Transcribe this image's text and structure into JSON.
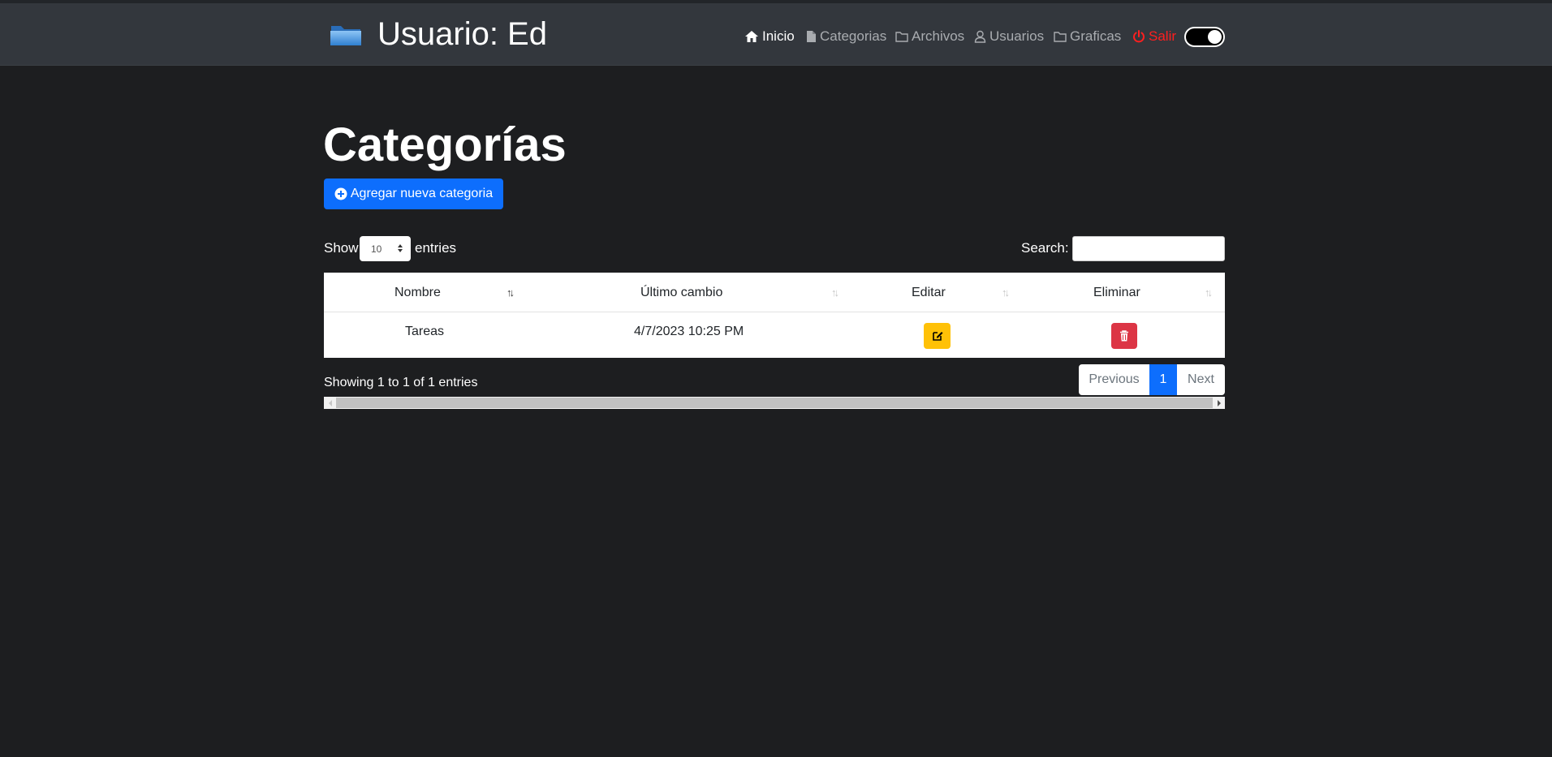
{
  "header": {
    "title": "Usuario: Ed",
    "nav": {
      "inicio": "Inicio",
      "categorias": "Categorias",
      "archivos": "Archivos",
      "usuarios": "Usuarios",
      "graficas": "Graficas",
      "salir": "Salir"
    }
  },
  "page": {
    "title": "Categorías",
    "add_button": "Agregar nueva categoria"
  },
  "table_controls": {
    "show_label": "Show",
    "page_length": "10",
    "entries_label": "entries",
    "search_label": "Search:",
    "search_value": ""
  },
  "table": {
    "columns": [
      "Nombre",
      "Último cambio",
      "Editar",
      "Eliminar"
    ],
    "rows": [
      {
        "nombre": "Tareas",
        "ultimo_cambio": "4/7/2023 10:25 PM"
      }
    ]
  },
  "footer": {
    "info": "Showing 1 to 1 of 1 entries",
    "previous": "Previous",
    "current_page": "1",
    "next": "Next"
  },
  "colors": {
    "background": "#1d1e20",
    "navbar": "#33373d",
    "primary": "#0d6efd",
    "warning": "#ffc107",
    "danger": "#dc3545",
    "logout": "#ff1f1f"
  },
  "icons": [
    "folder-icon",
    "home-icon",
    "file-icon",
    "folder-outline-icon",
    "user-icon",
    "power-icon",
    "plus-circle-icon",
    "edit-icon",
    "trash-icon"
  ]
}
